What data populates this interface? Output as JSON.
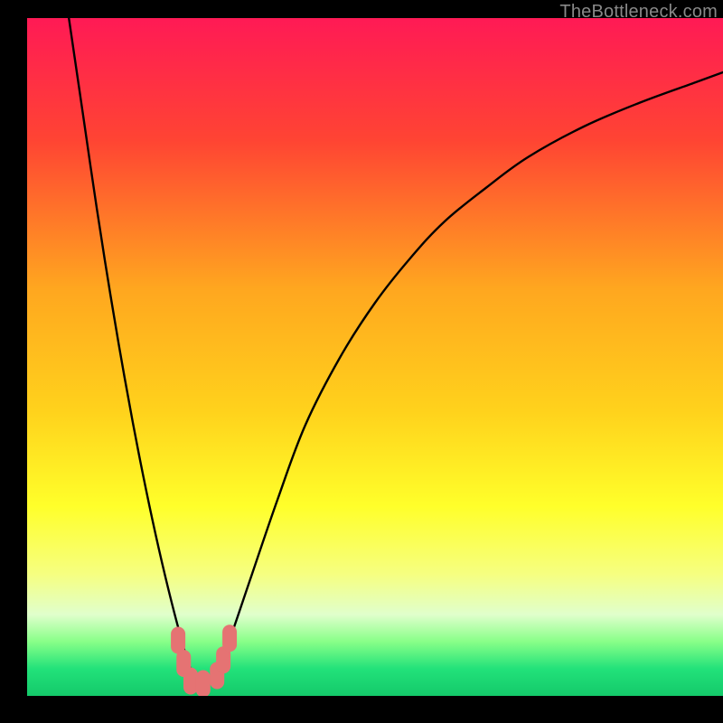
{
  "watermark": "TheBottleneck.com",
  "chart_data": {
    "type": "line",
    "title": "",
    "xlabel": "",
    "ylabel": "",
    "xlim": [
      0,
      100
    ],
    "ylim": [
      0,
      100
    ],
    "gradient_stops": [
      {
        "offset": 0.0,
        "color": "#ff1a55"
      },
      {
        "offset": 0.18,
        "color": "#ff4433"
      },
      {
        "offset": 0.4,
        "color": "#ffa71f"
      },
      {
        "offset": 0.58,
        "color": "#ffd21c"
      },
      {
        "offset": 0.72,
        "color": "#ffff2a"
      },
      {
        "offset": 0.82,
        "color": "#f6ff80"
      },
      {
        "offset": 0.88,
        "color": "#e0ffcc"
      },
      {
        "offset": 0.92,
        "color": "#88ff88"
      },
      {
        "offset": 0.96,
        "color": "#22e27a"
      },
      {
        "offset": 1.0,
        "color": "#14c96a"
      }
    ],
    "series": [
      {
        "name": "curve",
        "x": [
          6,
          8,
          10,
          12,
          14,
          16,
          18,
          20,
          22,
          23.5,
          25,
          27,
          29,
          32,
          36,
          40,
          45,
          50,
          55,
          60,
          66,
          72,
          80,
          88,
          96,
          100
        ],
        "values": [
          100,
          86,
          72,
          59,
          47,
          36,
          26,
          17,
          9,
          4,
          2,
          3,
          8,
          17,
          29,
          40,
          50,
          58,
          64.5,
          70,
          75,
          79.5,
          84,
          87.5,
          90.5,
          92
        ]
      }
    ],
    "markers": [
      {
        "x": 21.7,
        "y": 8.2
      },
      {
        "x": 22.5,
        "y": 4.8
      },
      {
        "x": 23.5,
        "y": 2.2
      },
      {
        "x": 25.3,
        "y": 1.8
      },
      {
        "x": 27.3,
        "y": 3.0
      },
      {
        "x": 28.2,
        "y": 5.3
      },
      {
        "x": 29.1,
        "y": 8.5
      }
    ],
    "marker_color": "#e57373",
    "curve_color": "#000000"
  }
}
